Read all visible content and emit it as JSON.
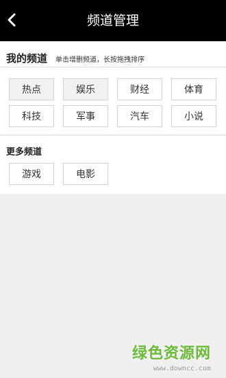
{
  "header": {
    "title": "频道管理",
    "back_icon": "chevron-left-icon"
  },
  "my_channels": {
    "title": "我的频道",
    "hint": "单击增删频道，长按拖拽排序",
    "items": [
      {
        "label": "热点"
      },
      {
        "label": "娱乐"
      },
      {
        "label": "财经"
      },
      {
        "label": "体育"
      },
      {
        "label": "科技"
      },
      {
        "label": "军事"
      },
      {
        "label": "汽车"
      },
      {
        "label": "小说"
      }
    ]
  },
  "more_channels": {
    "title": "更多频道",
    "items": [
      {
        "label": "游戏"
      },
      {
        "label": "电影"
      }
    ]
  },
  "watermark": {
    "logo": "绿色资源网",
    "url": "www.downcc.com"
  },
  "colors": {
    "topbar": "#000000",
    "background": "#f0f0f0",
    "panel": "#ffffff",
    "watermark": "#6dbb3a"
  }
}
